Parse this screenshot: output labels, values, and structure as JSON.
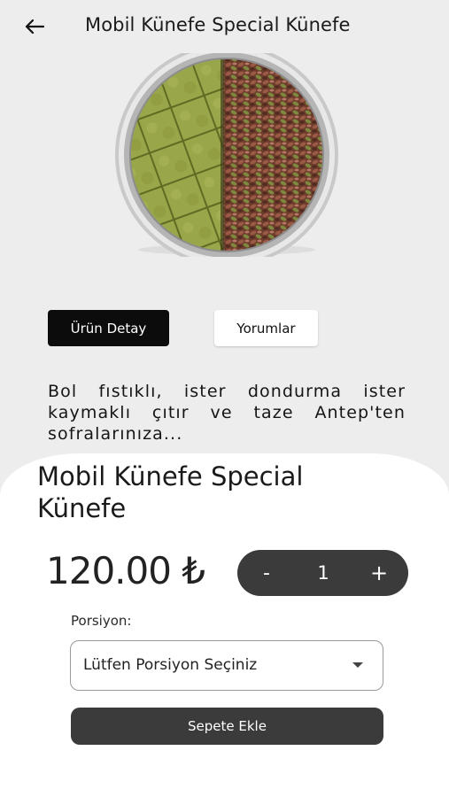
{
  "appbar": {
    "title": "Mobil Künefe Special Künefe",
    "back_icon": "arrow-left-icon"
  },
  "tabs": {
    "detail_label": "Ürün Detay",
    "reviews_label": "Yorumlar",
    "active": "detail"
  },
  "description": "Bol fıstıklı, ister dondurma ister kaymaklı çıtır ve taze Antep'ten sofralarınıza...",
  "product": {
    "name": "Mobil Künefe Special Künefe",
    "price": "120.00 ₺"
  },
  "quantity": {
    "minus_label": "-",
    "value": "1",
    "plus_label": "+"
  },
  "portion": {
    "label": "Porsiyon:",
    "selected": "Lütfen Porsiyon Seçiniz",
    "caret_icon": "caret-down-icon"
  },
  "cart": {
    "add_label": "Sepete Ekle"
  },
  "colors": {
    "background_top": "#ededed",
    "dark_button": "#3b3b3b",
    "active_tab": "#0c0c0c"
  }
}
